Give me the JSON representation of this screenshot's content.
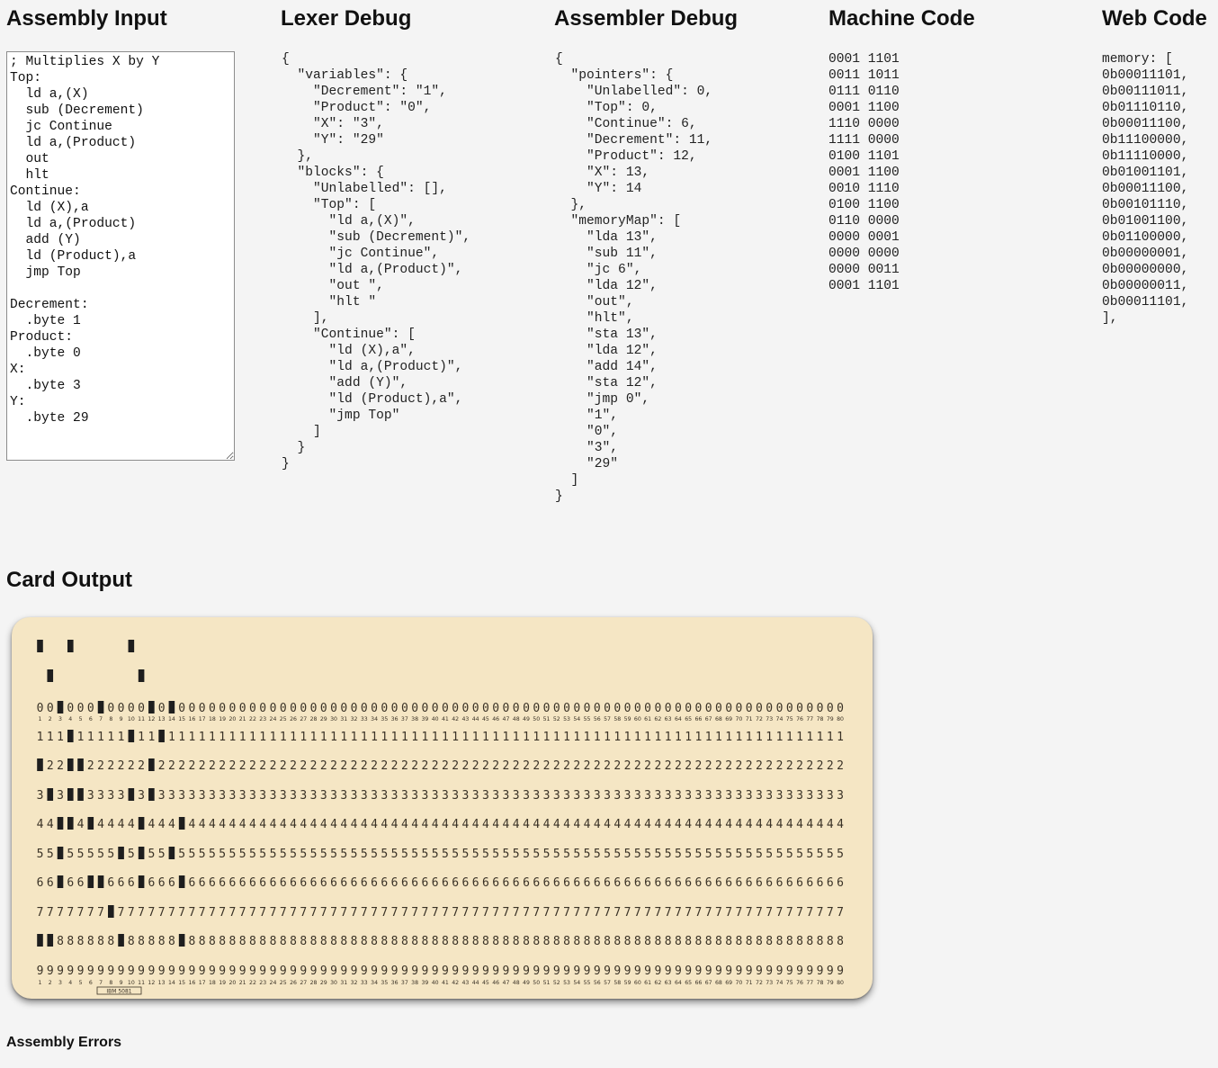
{
  "headings": {
    "assembly_input": "Assembly Input",
    "lexer_debug": "Lexer Debug",
    "assembler_debug": "Assembler Debug",
    "machine_code": "Machine Code",
    "web_code": "Web Code",
    "card_output": "Card Output",
    "assembly_errors": "Assembly Errors"
  },
  "assembly_source": "; Multiplies X by Y\nTop:\n  ld a,(X)\n  sub (Decrement)\n  jc Continue\n  ld a,(Product)\n  out\n  hlt\nContinue:\n  ld (X),a\n  ld a,(Product)\n  add (Y)\n  ld (Product),a\n  jmp Top\n\nDecrement:\n  .byte 1\nProduct:\n  .byte 0\nX:\n  .byte 3\nY:\n  .byte 29",
  "lexer_debug": "{\n  \"variables\": {\n    \"Decrement\": \"1\",\n    \"Product\": \"0\",\n    \"X\": \"3\",\n    \"Y\": \"29\"\n  },\n  \"blocks\": {\n    \"Unlabelled\": [],\n    \"Top\": [\n      \"ld a,(X)\",\n      \"sub (Decrement)\",\n      \"jc Continue\",\n      \"ld a,(Product)\",\n      \"out \",\n      \"hlt \"\n    ],\n    \"Continue\": [\n      \"ld (X),a\",\n      \"ld a,(Product)\",\n      \"add (Y)\",\n      \"ld (Product),a\",\n      \"jmp Top\"\n    ]\n  }\n}",
  "assembler_debug": "{\n  \"pointers\": {\n    \"Unlabelled\": 0,\n    \"Top\": 0,\n    \"Continue\": 6,\n    \"Decrement\": 11,\n    \"Product\": 12,\n    \"X\": 13,\n    \"Y\": 14\n  },\n  \"memoryMap\": [\n    \"lda 13\",\n    \"sub 11\",\n    \"jc 6\",\n    \"lda 12\",\n    \"out\",\n    \"hlt\",\n    \"sta 13\",\n    \"lda 12\",\n    \"add 14\",\n    \"sta 12\",\n    \"jmp 0\",\n    \"1\",\n    \"0\",\n    \"3\",\n    \"29\"\n  ]\n}",
  "machine_code": "0001 1101\n0011 1011\n0111 0110\n0001 1100\n1110 0000\n1111 0000\n0100 1101\n0001 1100\n0010 1110\n0100 1100\n0110 0000\n0000 0001\n0000 0000\n0000 0011\n0001 1101",
  "web_code": "memory: [\n0b00011101,\n0b00111011,\n0b01110110,\n0b00011100,\n0b11100000,\n0b11110000,\n0b01001101,\n0b00011100,\n0b00101110,\n0b01001100,\n0b01100000,\n0b00000001,\n0b00000000,\n0b00000011,\n0b00011101,\n],",
  "card": {
    "columns": 80,
    "digit_rows": [
      "0",
      "1",
      "2",
      "3",
      "4",
      "5",
      "6",
      "7",
      "8",
      "9"
    ],
    "column_numbers": [
      "1",
      "2",
      "3",
      "4",
      "5",
      "6",
      "7",
      "8",
      "9",
      "10",
      "11",
      "12",
      "13",
      "14",
      "15",
      "16",
      "17",
      "18",
      "19",
      "20",
      "21",
      "22",
      "23",
      "24",
      "25",
      "26",
      "27",
      "28",
      "29",
      "30",
      "31",
      "32",
      "33",
      "34",
      "35",
      "36",
      "37",
      "38",
      "39",
      "40",
      "41",
      "42",
      "43",
      "44",
      "45",
      "46",
      "47",
      "48",
      "49",
      "50",
      "51",
      "52",
      "53",
      "54",
      "55",
      "56",
      "57",
      "58",
      "59",
      "60",
      "61",
      "62",
      "63",
      "64",
      "65",
      "66",
      "67",
      "68",
      "69",
      "70",
      "71",
      "72",
      "73",
      "74",
      "75",
      "76",
      "77",
      "78",
      "79",
      "80"
    ],
    "stamp": "IBM 5081",
    "punch_codes": [
      "12:2-8",
      "11:3-8",
      "0-4:5-6",
      "12-1:2-3-4",
      "2-3",
      "4-6",
      "0-6",
      "7",
      "5-8",
      "12:1-3",
      "11:4-5-6",
      "0-2-3",
      "1",
      "0-5",
      "4-6-8"
    ],
    "colors": {
      "paper": "#f5e6c4",
      "ink": "#3a3226",
      "hole": "#1e1e1e"
    }
  }
}
